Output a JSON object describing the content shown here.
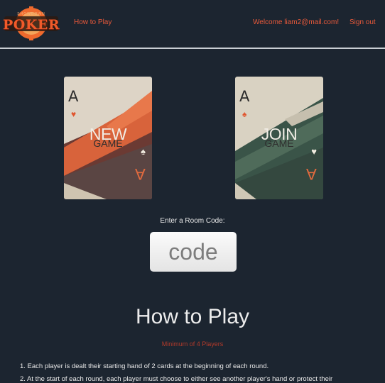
{
  "header": {
    "logo": {
      "small_text": "SHOWDOWN",
      "word": "POKER"
    },
    "nav_how_to_play": "How to Play",
    "welcome": "Welcome liam2@mail.com!",
    "sign_out": "Sign out"
  },
  "cards": {
    "new_game": {
      "rank": "A",
      "title": "NEW",
      "subtitle": "GAME",
      "suit_top_color": "#e0552e",
      "suit_bottom_color": "#f2ece0"
    },
    "join_game": {
      "rank": "A",
      "title": "JOIN",
      "subtitle": "GAME",
      "suit_top_color": "#e0552e",
      "suit_bottom_color": "#f2ece0"
    }
  },
  "room": {
    "label": "Enter a Room Code:",
    "placeholder": "code",
    "value": ""
  },
  "how_to_play": {
    "title": "How to Play",
    "min_players": "Minimum of 4 Players",
    "rules": [
      "1. Each player is dealt their starting hand of 2 cards at the beginning of each round.",
      "2. At the start of each round, each player must choose to either see another player's hand or protect their"
    ]
  },
  "colors": {
    "background": "#1c2530",
    "accent": "#e8593a",
    "new_card_bg": "#ddd4c6",
    "new_card_stripe": "#e0683f",
    "join_card_bg": "#3a5448",
    "join_card_stripe": "#cfc8b6"
  }
}
